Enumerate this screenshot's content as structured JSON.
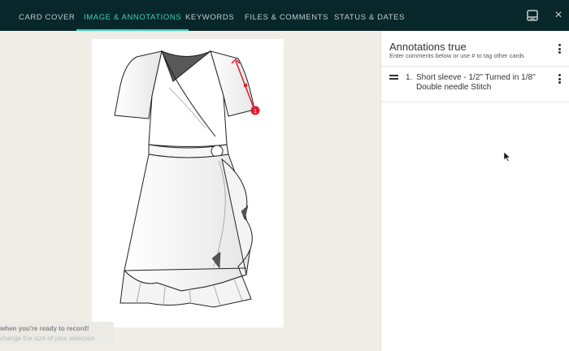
{
  "tabs": [
    {
      "label": "CARD COVER"
    },
    {
      "label": "IMAGE & ANNOTATIONS"
    },
    {
      "label": "KEYWORDS"
    },
    {
      "label": "FILES & COMMENTS"
    },
    {
      "label": "STATUS & DATES"
    }
  ],
  "active_tab": "IMAGE & ANNOTATIONS",
  "top_icons": {
    "panel_toggle": "panel-bottom-icon",
    "close": "close-icon",
    "close_glyph": "×"
  },
  "colors": {
    "topbar": "#07272b",
    "accent": "#3fd0b6",
    "marker": "#e8192c",
    "canvas_bg": "#f0ede6"
  },
  "annotations_panel": {
    "title": "Annotations true",
    "subtitle": "Enter comments below or use # to tag other cards",
    "items": [
      {
        "number": "1.",
        "text": "Short sleeve - 1/2\" Turned in 1/8\" Double needle Stitch"
      }
    ]
  },
  "image": {
    "subject": "wrap dress technical flat sketch",
    "marker_label": "1"
  },
  "recording_toast": {
    "line1": "when you're ready to record!",
    "line2": "change the size of your selection"
  }
}
